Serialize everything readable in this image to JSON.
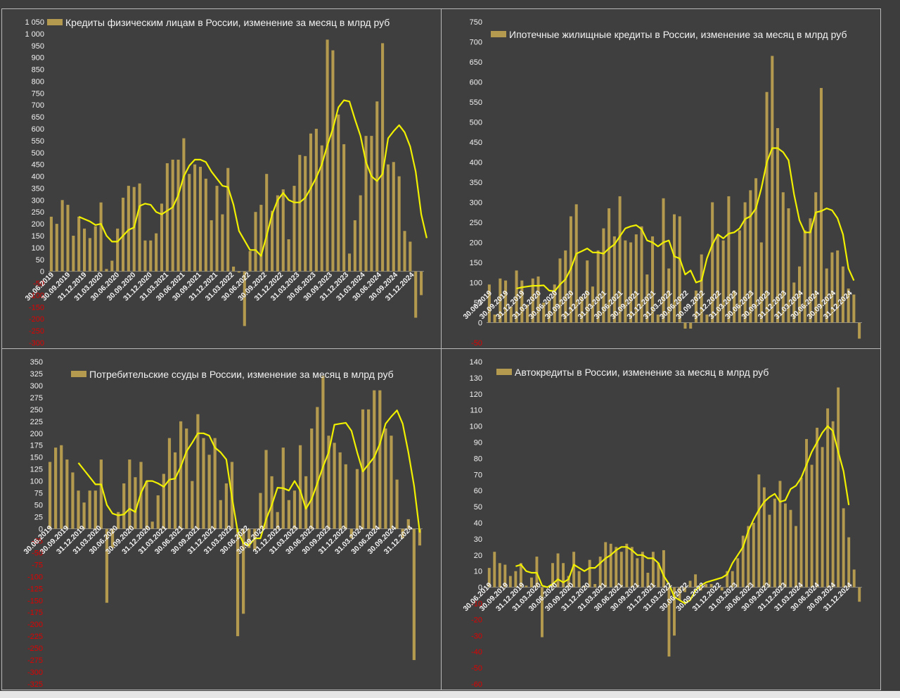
{
  "colors": {
    "bar": "#b39a4e",
    "line": "#f0f000",
    "negative_tick": "#e00000",
    "text": "#f2f2f2",
    "background": "#3f3f3f"
  },
  "chart_data": [
    {
      "type": "bar",
      "title": "Кредиты физическим лицам  в России, изменение за месяц в млрд руб",
      "legend_position": "top",
      "ylim": [
        -300,
        1050
      ],
      "yticks": [
        "1 050",
        "1 000",
        "950",
        "900",
        "850",
        "800",
        "750",
        "700",
        "650",
        "600",
        "550",
        "500",
        "450",
        "400",
        "350",
        "300",
        "250",
        "200",
        "150",
        "100",
        "50",
        "0",
        "-50",
        "-100",
        "-150",
        "-200",
        "-250",
        "-300"
      ],
      "xticks": [
        "30.06.2019",
        "30.09.2019",
        "31.12.2019",
        "31.03.2020",
        "30.06.2020",
        "30.09.2020",
        "31.12.2020",
        "31.03.2021",
        "30.06.2021",
        "30.09.2021",
        "31.12.2021",
        "31.03.2022",
        "30.06.2022",
        "30.09.2022",
        "31.12.2022",
        "31.03.2023",
        "30.06.2023",
        "30.09.2023",
        "31.12.2023",
        "31.03.2024",
        "30.06.2024",
        "30.09.2024",
        "31.12.2024"
      ],
      "series": [
        {
          "type": "bar",
          "values": [
            230,
            200,
            300,
            280,
            150,
            230,
            180,
            140,
            190,
            290,
            10,
            45,
            180,
            310,
            360,
            355,
            370,
            130,
            130,
            160,
            285,
            455,
            470,
            470,
            560,
            410,
            450,
            440,
            390,
            215,
            360,
            240,
            435,
            20,
            -5,
            -230,
            85,
            250,
            280,
            410,
            255,
            320,
            345,
            135,
            360,
            490,
            485,
            580,
            600,
            530,
            975,
            930,
            660,
            535,
            75,
            215,
            320,
            570,
            570,
            715,
            960,
            450,
            460,
            400,
            170,
            125,
            -195,
            -100
          ]
        },
        {
          "type": "line",
          "values": [
            null,
            null,
            null,
            null,
            null,
            230,
            220,
            210,
            195,
            200,
            150,
            125,
            125,
            150,
            175,
            185,
            275,
            285,
            280,
            250,
            240,
            255,
            270,
            320,
            400,
            445,
            470,
            470,
            460,
            420,
            390,
            360,
            355,
            280,
            170,
            130,
            90,
            90,
            65,
            150,
            240,
            300,
            330,
            300,
            290,
            290,
            310,
            350,
            395,
            450,
            530,
            600,
            690,
            720,
            715,
            640,
            570,
            460,
            400,
            380,
            410,
            560,
            590,
            615,
            585,
            525,
            420,
            240,
            140
          ]
        }
      ]
    },
    {
      "type": "bar",
      "title": "Ипотечные жилищные кредиты в России, изменение за месяц в млрд руб",
      "legend_position": "top",
      "ylim": [
        -50,
        750
      ],
      "yticks": [
        "750",
        "700",
        "650",
        "600",
        "550",
        "500",
        "450",
        "400",
        "350",
        "300",
        "250",
        "200",
        "150",
        "100",
        "50",
        "0",
        "-50"
      ],
      "xticks": [
        "30.06.2019",
        "30.09.2019",
        "31.12.2019",
        "31.03.2020",
        "30.06.2020",
        "30.09.2020",
        "31.12.2020",
        "31.03.2021",
        "30.06.2021",
        "30.09.2021",
        "31.12.2021",
        "31.03.2022",
        "30.06.2022",
        "30.09.2022",
        "31.12.2022",
        "31.03.2023",
        "30.06.2023",
        "30.09.2023",
        "31.12.2023",
        "31.03.2024",
        "30.06.2024",
        "30.09.2024",
        "31.12.2024"
      ],
      "series": [
        {
          "type": "bar",
          "values": [
            95,
            20,
            110,
            105,
            40,
            130,
            105,
            45,
            110,
            115,
            50,
            55,
            95,
            160,
            180,
            265,
            295,
            65,
            155,
            90,
            180,
            235,
            285,
            215,
            315,
            205,
            200,
            220,
            240,
            120,
            215,
            20,
            310,
            135,
            270,
            265,
            -15,
            -15,
            80,
            170,
            20,
            300,
            220,
            205,
            315,
            80,
            230,
            300,
            330,
            360,
            200,
            575,
            665,
            485,
            325,
            285,
            100,
            140,
            230,
            260,
            325,
            585,
            135,
            175,
            180,
            140,
            85,
            70,
            -40
          ]
        },
        {
          "type": "line",
          "values": [
            null,
            null,
            null,
            null,
            null,
            85,
            88,
            90,
            92,
            92,
            93,
            80,
            78,
            95,
            108,
            135,
            172,
            178,
            185,
            175,
            175,
            172,
            185,
            195,
            215,
            235,
            240,
            243,
            233,
            205,
            200,
            190,
            200,
            205,
            165,
            160,
            120,
            130,
            100,
            105,
            160,
            195,
            220,
            210,
            222,
            225,
            235,
            258,
            265,
            285,
            335,
            400,
            435,
            435,
            425,
            405,
            320,
            255,
            225,
            225,
            275,
            278,
            285,
            280,
            260,
            220,
            135,
            105
          ]
        }
      ]
    },
    {
      "type": "bar",
      "title": "Потребительские ссуды в России, изменение за месяц в млрд руб",
      "legend_position": "top",
      "ylim": [
        -325,
        350
      ],
      "yticks": [
        "350",
        "325",
        "300",
        "275",
        "250",
        "225",
        "200",
        "175",
        "150",
        "125",
        "100",
        "75",
        "50",
        "25",
        "0",
        "-25",
        "-50",
        "-75",
        "-100",
        "-125",
        "-150",
        "-175",
        "-200",
        "-225",
        "-250",
        "-275",
        "-300",
        "-325"
      ],
      "xticks": [
        "30.06.2019",
        "30.09.2019",
        "31.12.2019",
        "31.03.2020",
        "30.06.2020",
        "30.09.2020",
        "31.12.2020",
        "31.03.2021",
        "30.06.2021",
        "30.09.2021",
        "31.12.2021",
        "31.03.2022",
        "30.06.2022",
        "30.09.2022",
        "31.12.2022",
        "31.03.2023",
        "30.06.2023",
        "30.09.2023",
        "31.12.2023",
        "31.03.2024",
        "30.06.2024",
        "30.09.2024",
        "31.12.2024"
      ],
      "series": [
        {
          "type": "bar",
          "values": [
            140,
            170,
            175,
            145,
            118,
            80,
            55,
            80,
            80,
            145,
            -155,
            -40,
            35,
            95,
            145,
            108,
            140,
            100,
            15,
            70,
            115,
            190,
            160,
            225,
            210,
            100,
            240,
            190,
            155,
            190,
            60,
            95,
            140,
            -225,
            -178,
            -40,
            -45,
            75,
            165,
            110,
            35,
            170,
            60,
            80,
            175,
            110,
            210,
            255,
            320,
            195,
            180,
            160,
            135,
            -20,
            125,
            250,
            250,
            290,
            290,
            210,
            195,
            103,
            -20,
            20,
            -275,
            -35
          ]
        },
        {
          "type": "line",
          "values": [
            null,
            null,
            null,
            null,
            null,
            138,
            123,
            108,
            93,
            93,
            50,
            32,
            28,
            30,
            42,
            35,
            75,
            100,
            100,
            95,
            88,
            103,
            105,
            130,
            162,
            180,
            200,
            200,
            195,
            170,
            160,
            145,
            65,
            -5,
            -30,
            -35,
            -20,
            -20,
            20,
            50,
            86,
            85,
            80,
            100,
            80,
            42,
            62,
            95,
            130,
            160,
            218,
            220,
            222,
            205,
            160,
            120,
            135,
            150,
            178,
            220,
            235,
            248,
            220,
            160,
            90,
            -8
          ]
        }
      ]
    },
    {
      "type": "bar",
      "title": "Автокредиты в России, изменение за месяц в млрд руб",
      "legend_position": "top",
      "ylim": [
        -60,
        140
      ],
      "yticks": [
        "140",
        "130",
        "120",
        "110",
        "100",
        "90",
        "80",
        "70",
        "60",
        "50",
        "40",
        "30",
        "20",
        "10",
        "0",
        "-10",
        "-20",
        "-30",
        "-40",
        "-50",
        "-60"
      ],
      "xticks": [
        "30.06.2019",
        "30.09.2019",
        "31.12.2019",
        "31.03.2020",
        "30.06.2020",
        "30.09.2020",
        "31.12.2020",
        "31.03.2021",
        "30.06.2021",
        "30.09.2021",
        "31.12.2021",
        "31.03.2022",
        "30.06.2022",
        "30.09.2022",
        "31.12.2022",
        "31.03.2023",
        "30.06.2023",
        "30.09.2023",
        "31.12.2023",
        "31.03.2024",
        "30.06.2024",
        "30.09.2024",
        "31.12.2024"
      ],
      "series": [
        {
          "type": "bar",
          "values": [
            12,
            22,
            15,
            14,
            7,
            10,
            15,
            1,
            6,
            19,
            -31,
            0,
            15,
            21,
            15,
            7,
            22,
            10,
            1,
            17,
            2,
            19,
            28,
            27,
            25,
            22,
            27,
            25,
            18,
            22,
            9,
            22,
            15,
            23,
            -43,
            -30,
            -8,
            -3,
            4,
            8,
            -2,
            2,
            2,
            0,
            -2,
            10,
            10,
            18,
            32,
            38,
            40,
            70,
            62,
            45,
            55,
            66,
            52,
            48,
            38,
            68,
            92,
            76,
            99,
            87,
            111,
            103,
            124,
            49,
            31,
            11,
            -9
          ]
        },
        {
          "type": "line",
          "values": [
            null,
            null,
            null,
            null,
            null,
            13,
            14,
            10,
            9,
            9,
            1,
            0,
            2,
            5,
            3,
            5,
            14,
            12,
            10,
            12,
            12,
            15,
            18,
            20,
            23,
            25,
            25,
            23,
            20,
            20,
            18,
            18,
            15,
            7,
            2,
            -6,
            -8,
            -10,
            -8,
            -2,
            1,
            3,
            4,
            5,
            6,
            8,
            15,
            20,
            25,
            35,
            42,
            48,
            53,
            56,
            58,
            53,
            54,
            61,
            63,
            68,
            76,
            84,
            90,
            96,
            100,
            97,
            84,
            72,
            51
          ]
        }
      ]
    }
  ]
}
